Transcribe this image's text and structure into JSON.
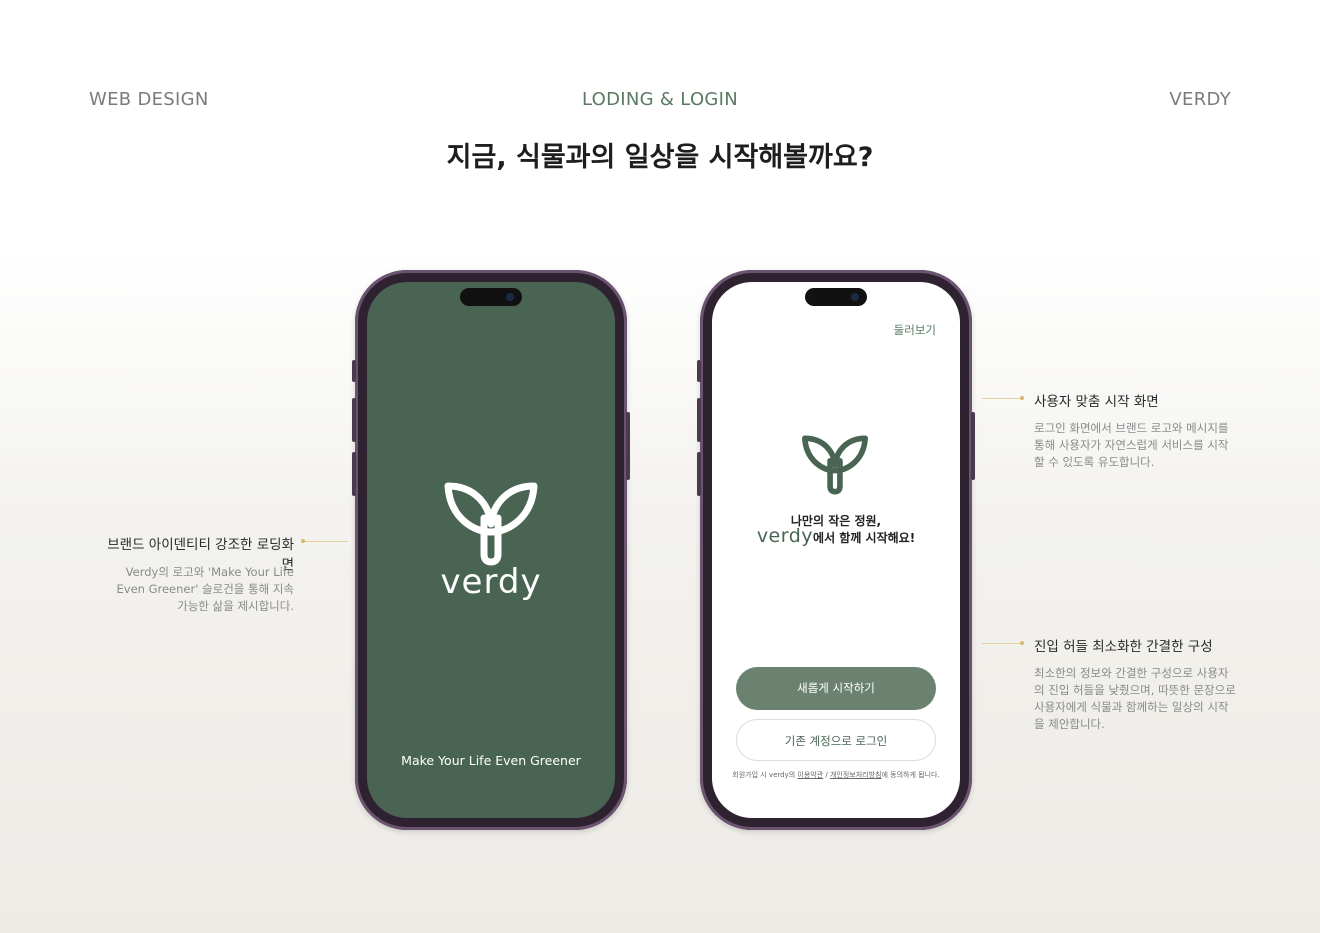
{
  "header": {
    "left": "WEB DESIGN",
    "center": "LODING & LOGIN",
    "right": "VERDY",
    "headline": "지금, 식물과의 일상을 시작해볼까요?"
  },
  "loading_screen": {
    "brand": "verdy",
    "slogan": "Make Your Life Even Greener"
  },
  "login_screen": {
    "browse_link": "둘러보기",
    "welcome_line1": "나만의 작은 정원,",
    "welcome_brand": "verdy",
    "welcome_line2_rest": "에서 함께 시작해요!",
    "primary_button": "새롭게 시작하기",
    "secondary_button": "기존 계정으로 로그인",
    "terms_prefix": "회원가입 시 verdy의",
    "terms_link1": "이용약관",
    "terms_sep": " / ",
    "terms_link2": "개인정보처리방침",
    "terms_suffix": "에 동의하게 됩니다."
  },
  "annotations": {
    "left": {
      "title": "브랜드 아이덴티티 강조한 로딩화면",
      "line1": "Verdy의 로고와 'Make Your Life",
      "line2": "Even Greener' 슬로건을 통해 지속",
      "line3": "가능한 삶을 제시합니다."
    },
    "right_top": {
      "title": "사용자 맞춤 시작 화면",
      "line1": "로그인 화면에서 브랜드 로고와 메시지를",
      "line2": "통해 사용자가 자연스럽게 서비스를 시작",
      "line3": "할 수 있도록 유도합니다."
    },
    "right_bottom": {
      "title": "진입 허들 최소화한 간결한 구성",
      "line1": "최소한의 정보와 간결한 구성으로 사용자",
      "line2": "의 진입 허들을 낮췄으며, 따뜻한 문장으로",
      "line3": "사용자에게 식물과 함께하는 일상의 시작",
      "line4": "을 제안합니다."
    }
  },
  "colors": {
    "brand_green": "#4a6453",
    "button_green": "#6b8271",
    "header_accent": "#5a7a63",
    "phone_frame": "#2e2230",
    "annotation_line": "#e5cf9e"
  },
  "icons": [
    "verdy-leaf-logo-icon",
    "camera-icon"
  ]
}
